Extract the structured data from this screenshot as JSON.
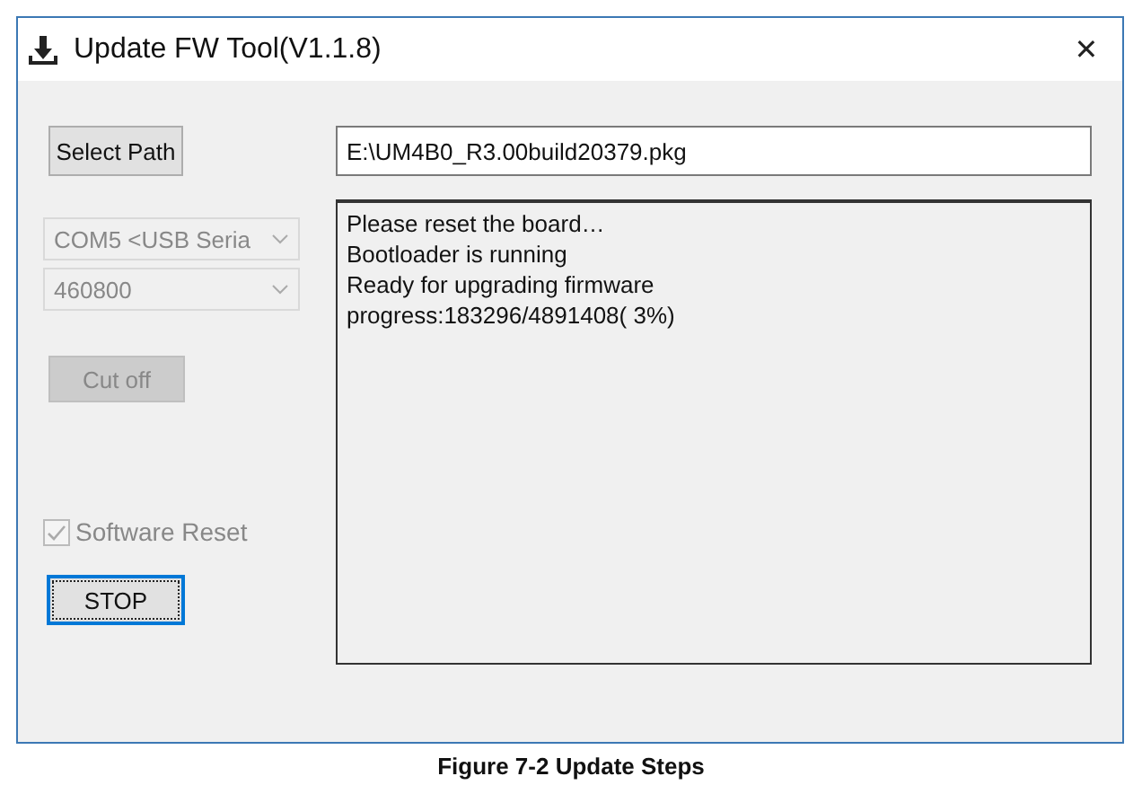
{
  "window": {
    "title": "Update FW Tool(V1.1.8)",
    "close": "✕"
  },
  "select_path_button": {
    "label": "Select Path",
    "disabled": false
  },
  "path_field": {
    "value": "E:\\UM4B0_R3.00build20379.pkg"
  },
  "port_dropdown": {
    "value": "COM5 <USB Seria",
    "disabled": true
  },
  "baud_dropdown": {
    "value": "460800",
    "disabled": true
  },
  "cut_off_button": {
    "label": "Cut off",
    "disabled": true
  },
  "software_reset": {
    "label": "Software Reset",
    "checked": true,
    "disabled": true
  },
  "stop_button": {
    "label": "STOP",
    "focused": true
  },
  "log": [
    "Please reset the board…",
    "Bootloader is running",
    "Ready for upgrading firmware",
    "progress:183296/4891408( 3%)"
  ],
  "caption": "Figure 7-2 Update Steps"
}
